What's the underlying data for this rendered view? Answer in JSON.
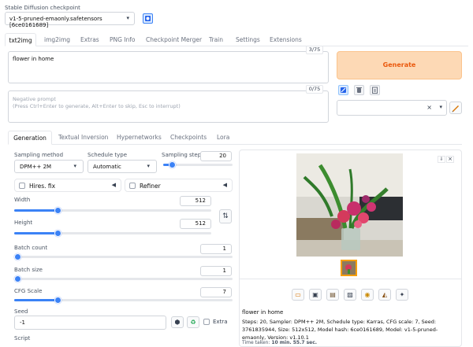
{
  "checkpoint": {
    "label": "Stable Diffusion checkpoint",
    "value": "v1-5-pruned-emaonly.safetensors [6ce0161689]"
  },
  "main_tabs": [
    "txt2img",
    "img2img",
    "Extras",
    "PNG Info",
    "Checkpoint Merger",
    "Train",
    "Settings",
    "Extensions"
  ],
  "prompt": {
    "value": "flower in home",
    "counter": "3/75"
  },
  "negative_prompt": {
    "placeholder": "Negative prompt\n(Press Ctrl+Enter to generate, Alt+Enter to skip, Esc to interrupt)",
    "counter": "0/75"
  },
  "generate_label": "Generate",
  "style_clear": "×",
  "sub_tabs": [
    "Generation",
    "Textual Inversion",
    "Hypernetworks",
    "Checkpoints",
    "Lora"
  ],
  "sampling": {
    "method_label": "Sampling method",
    "method_value": "DPM++ 2M",
    "schedule_label": "Schedule type",
    "schedule_value": "Automatic",
    "steps_label": "Sampling steps",
    "steps_value": "20",
    "steps_fraction": 0.13
  },
  "hires_label": "Hires. fix",
  "refiner_label": "Refiner",
  "width": {
    "label": "Width",
    "value": "512",
    "fraction": 0.22
  },
  "height": {
    "label": "Height",
    "value": "512",
    "fraction": 0.22
  },
  "batch_count": {
    "label": "Batch count",
    "value": "1",
    "fraction": 0.0
  },
  "batch_size": {
    "label": "Batch size",
    "value": "1",
    "fraction": 0.0
  },
  "cfg": {
    "label": "CFG Scale",
    "value": "7",
    "fraction": 0.2
  },
  "seed": {
    "label": "Seed",
    "value": "-1",
    "extra_label": "Extra"
  },
  "script_label": "Script",
  "output": {
    "caption": "flower in home",
    "info": "Steps: 20, Sampler: DPM++ 2M, Schedule type: Karras, CFG scale: 7, Seed: 3761835944, Size: 512x512, Model hash: 6ce0161689, Model: v1-5-pruned-emaonly, Version: v1.10.1",
    "time_prefix": "Time taken:",
    "time_value": "10 min. 55.7 sec."
  },
  "colors": {
    "accent": "#3b82f6",
    "generate_bg": "#fdd9b5",
    "generate_text": "#ea580c"
  }
}
